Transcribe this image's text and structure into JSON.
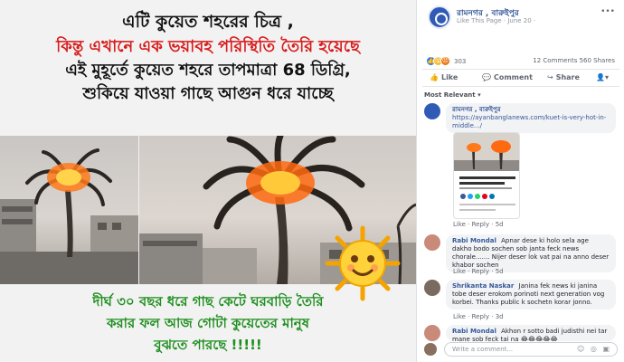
{
  "headline": {
    "line1": "এটি কুয়েত শহরের চিত্র ,",
    "line2": "কিন্তু এখানে এক ভয়াবহ পরিস্থিতি তৈরি হয়েছে",
    "line3": "এই মুহূর্তে কুয়েত শহরে তাপমাত্রা 68 ডিগ্রি,",
    "line4": "শুকিয়ে যাওয়া গাছে আগুন ধরে যাচ্ছে"
  },
  "caption": {
    "line1": "দীর্ঘ ৩০ বছর ধরে গাছ কেটে ঘরবাড়ি তৈরি",
    "line2": "করার ফল আজ গোটা কুয়েতের মানুষ",
    "line3": "বুঝতে পারছে !!!!!"
  },
  "post": {
    "page_name": "রামনগর , বারুইপুর",
    "page_sub": "Like This Page · June 20 ·",
    "reaction_count": "303",
    "comment_share_counts": "12 Comments  560 Shares"
  },
  "actions": {
    "like": "Like",
    "comment": "Comment",
    "share": "Share"
  },
  "icons": {
    "like": "thumbs-up-icon",
    "comment": "speech-bubble-icon",
    "share": "share-arrow-icon",
    "more": "chevron-down-icon"
  },
  "colors": {
    "facebook_blue": "#365899",
    "headline_red": "#d81b1b",
    "caption_green": "#1f8f1f"
  },
  "sort_label": "Most Relevant ▾",
  "comments": [
    {
      "author": "রামনগর , বারুইপুর",
      "text": "https://ayanbanglanews.com/kuet-is-very-hot-in-middle.../",
      "footer": "Like · Reply · 5d"
    },
    {
      "author": "Rabi Mondal",
      "text": "Apnar dese ki holo sela age dakho bodo sochen sob janta feck news chorale....... Nijer deser lok vat pai na anno deser khabor sochen",
      "footer": "Like · Reply · 5d"
    },
    {
      "author": "Shrikanta Naskar",
      "text": "Janina fek news ki janina tobe deser erokom porinoti next generation vog korbei. Thanks public k sochetn korar jonno.",
      "footer": "Like · Reply · 3d"
    },
    {
      "author": "Rabi Mondal",
      "text": "Akhon r sotto badi judisthi nei tar mane sob feck tai na 😂😂😂😂😂"
    }
  ],
  "write_placeholder": "Write a comment..."
}
